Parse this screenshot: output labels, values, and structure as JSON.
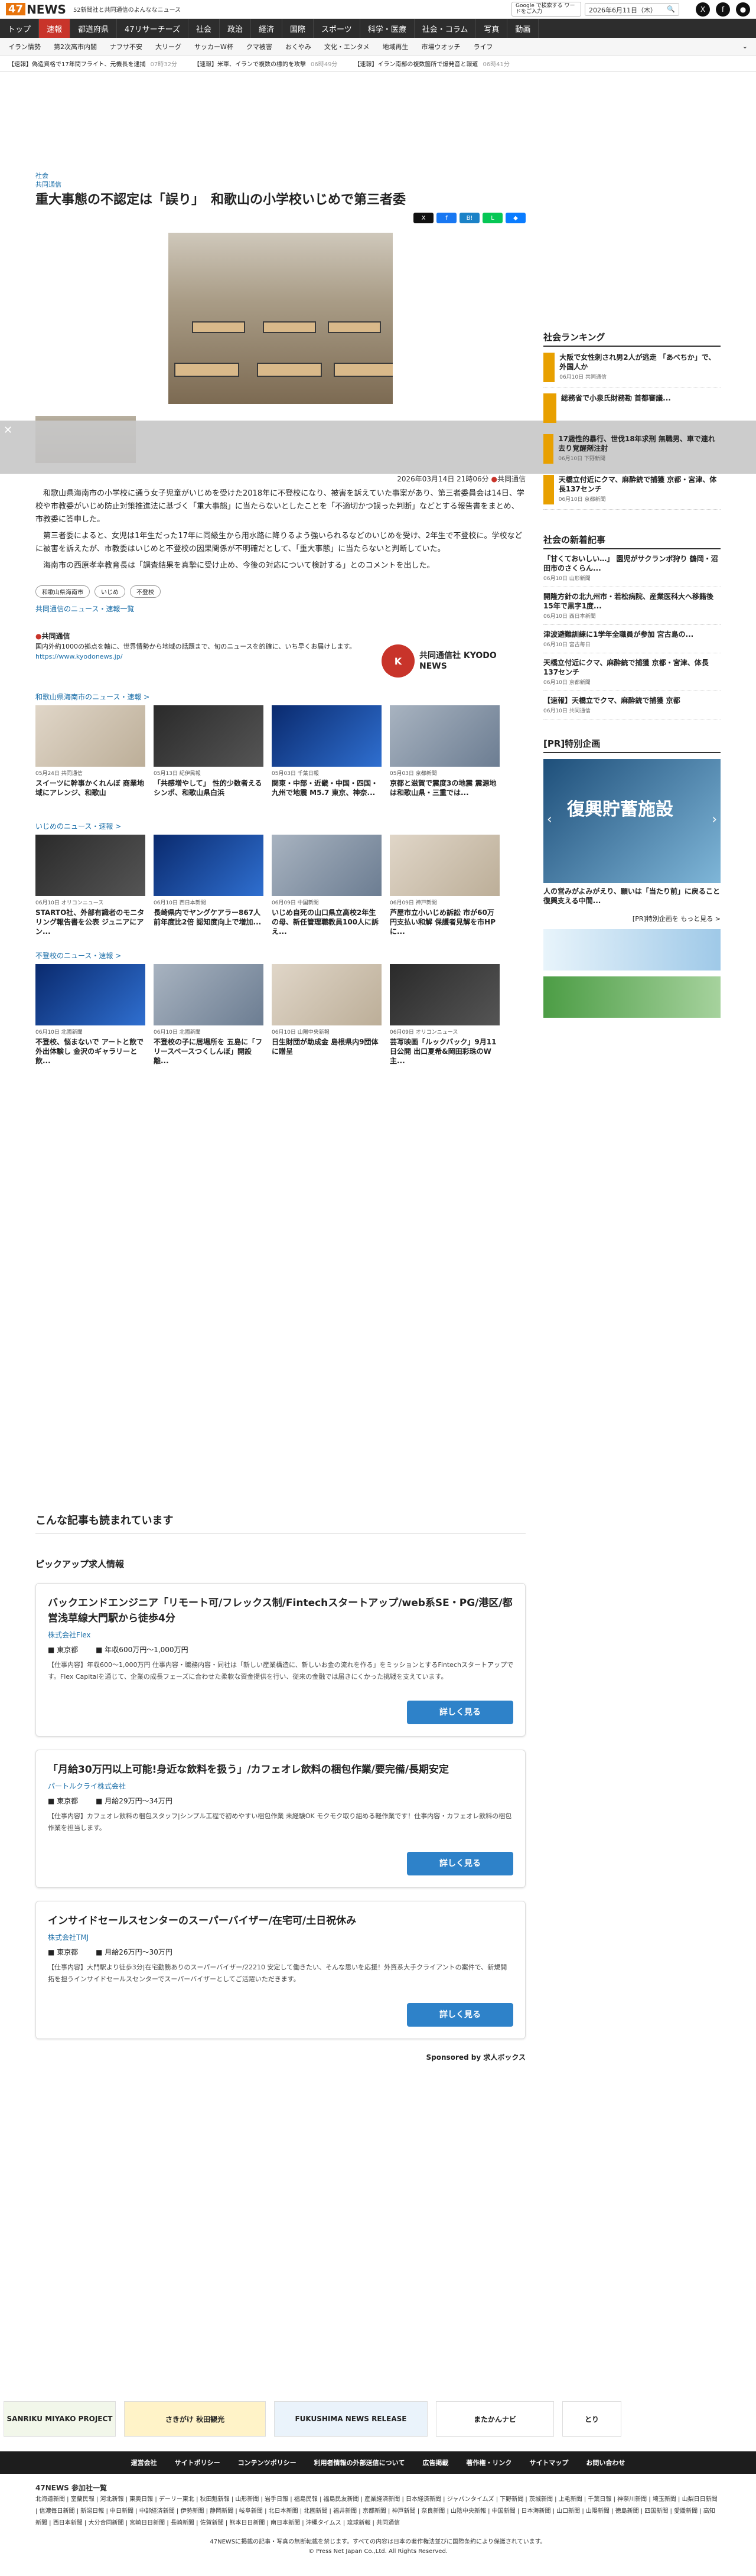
{
  "header": {
    "logo": "47NEWS",
    "tagline": "52新聞社と共同通信のよんななニュース",
    "google": "Google で検索する ワードをご入力",
    "date": "2026年6月11日（木）"
  },
  "nav": [
    "トップ",
    "速報",
    "都道府県",
    "47リサーチーズ",
    "社会",
    "政治",
    "経済",
    "国際",
    "スポーツ",
    "科学・医療",
    "社会・コラム",
    "写真",
    "動画"
  ],
  "subnav": [
    "イラン情勢",
    "第2次高市内閣",
    "ナフサ不安",
    "大リーグ",
    "サッカーW杯",
    "クマ被害",
    "おくやみ",
    "文化・エンタメ",
    "地域再生",
    "市場ウオッチ",
    "ライフ"
  ],
  "ticker": [
    {
      "t": "【速報】偽造資格で17年間フライト、元機長を逮捕",
      "time": "07時32分"
    },
    {
      "t": "【速報】米軍、イランで複数の標的を攻撃",
      "time": "06時49分"
    },
    {
      "t": "【速報】イラン南部の複数箇所で爆発音と報道",
      "time": "06時41分"
    }
  ],
  "article": {
    "category": "社会",
    "source_label": "共同通信",
    "title": "重大事態の不認定は「誤り」　和歌山の小学校いじめで第三者委",
    "meta": "2026年03月14日 21時06分",
    "meta_src": "共同通信",
    "paragraphs": [
      "和歌山県海南市の小学校に通う女子児童がいじめを受けた2018年に不登校になり、被害を訴えていた事案があり、第三者委員会は14日、学校や市教委がいじめ防止対策推進法に基づく「重大事態」に当たらないとしたことを「不適切かつ誤った判断」などとする報告書をまとめ、市教委に答申した。",
      "第三者委によると、女児は1年生だった17年に同級生から用水路に降りるよう強いられるなどのいじめを受け、2年生で不登校に。学校などに被害を訴えたが、市教委はいじめと不登校の因果関係が不明確だとして、「重大事態」に当たらないと判断していた。",
      "海南市の西原孝幸教育長は「調査結果を真摯に受け止め、今後の対応について検討する」とのコメントを出した。"
    ],
    "tags": [
      "和歌山県海南市",
      "いじめ",
      "不登校"
    ],
    "list_link": "共同通信のニュース・速報一覧"
  },
  "kyodo": {
    "name": "共同通信",
    "desc": "国内外約1000の拠点を軸に、世界情勢から地域の話題まで、旬のニュースを的確に、いち早くお届けします。",
    "url": "https://www.kyodonews.jp/",
    "logo": "共同通信社 KYODO NEWS"
  },
  "sections": [
    {
      "title": "和歌山県海南市のニュース・速報 >",
      "cards": [
        {
          "src": "05月24日 共同通信",
          "t": "スイーツに幹事かくれんぼ 商業地域にアレンジ、和歌山"
        },
        {
          "src": "05月13日 紀伊民報",
          "t": "「共感増やして」 性的少数者えるシンポ、和歌山県白浜"
        },
        {
          "src": "05月03日 千葉日報",
          "t": "関東・中部・近畿・中国・四国・九州で地震 M5.7 東京、神奈..."
        },
        {
          "src": "05月03日 京都新聞",
          "t": "京都と滋賀で震度3の地震 震源地は和歌山県・三重では..."
        }
      ]
    },
    {
      "title": "いじめのニュース・速報 >",
      "cards": [
        {
          "src": "06月10日 オリコンニュース",
          "t": "STARTO社、外部有識者のモニタリング報告書を公表 ジュニアにアン..."
        },
        {
          "src": "06月10日 西日本新聞",
          "t": "長崎県内でヤングケアラー867人 前年度比2倍 認知度向上で増加..."
        },
        {
          "src": "06月09日 中国新聞",
          "t": "いじめ自死の山口県立高校2年生の母、新任管理職教員100人に訴え..."
        },
        {
          "src": "06月09日 神戸新聞",
          "t": "芦屋市立小いじめ訴訟 市が60万円支払い和解 保護者見解を市HPに..."
        }
      ]
    },
    {
      "title": "不登校のニュース・速報 >",
      "cards": [
        {
          "src": "06月10日 北國新聞",
          "t": "不登校、悩まないで アートと飲で外出体験し 金沢のギャラリーと飲..."
        },
        {
          "src": "06月10日 北國新聞",
          "t": "不登校の子に居場所を 五島に「フリースペースつくしんぼ」開設 離..."
        },
        {
          "src": "06月10日 山陽中央新報",
          "t": "日生財団が助成金 島根県内9団体に贈呈"
        },
        {
          "src": "06月09日 オリコンニュース",
          "t": "芸写映画「ルックバック」9月11日公開 出口夏希&岡田彩珠のW主..."
        }
      ]
    }
  ],
  "ranking": {
    "title": "社会ランキング",
    "items": [
      {
        "t": "大阪で女性刺され男2人が逃走 「あべちか」で、外国人か",
        "s": "06月10日 共同通信"
      },
      {
        "t": "総務省で小泉氏財務勘 首都審議...",
        "s": ""
      },
      {
        "t": "17歳性的暴行、世伐18年求刑 無職男、車で連れ去り覚醒剤注射",
        "s": "06月10日 下野新聞"
      },
      {
        "t": "天橋立付近にクマ、麻酔銃で捕獲 京都・宮津、体長137センチ",
        "s": "06月10日 京都新聞"
      }
    ]
  },
  "newest": {
    "title": "社会の新着記事",
    "items": [
      {
        "t": "「甘くておいしい…」 園児がサクランボ狩り 鶴岡・沼田市のさくらん...",
        "s": "06月10日 山形新聞"
      },
      {
        "t": "開隆方針の北九州市・若松病院、産業医科大へ移籍後15年で黒字1度...",
        "s": "06月10日 西日本新聞"
      },
      {
        "t": "津波避難訓練に1学年全職員が参加 宮古島の...",
        "s": "06月10日 宮古毎日"
      },
      {
        "t": "天橋立付近にクマ、麻酔銃で捕獲 京都・宮津、体長137センチ",
        "s": "06月10日 京都新聞"
      },
      {
        "t": "【速報】天橋立でクマ、麻酔銃で捕獲 京都",
        "s": "06月10日 共同通信"
      }
    ]
  },
  "pr": {
    "title": "[PR]特別企画",
    "ad_text": "復興貯蓄施設",
    "caption": "人の営みがよみがえり、願いは「当たり前」に戻ること 復興支える中間...",
    "more": "[PR]特別企画を もっと見る >"
  },
  "jobs": {
    "read_more": "こんな記事も読まれています",
    "heading": "ピックアップ求人情報",
    "sponsor": "Sponsored by 求人ボックス",
    "items": [
      {
        "t": "バックエンドエンジニア「リモート可/フレックス制/Fintechスタートアップ/web系SE・PG/港区/都営浅草線大門駅から徒歩4分",
        "c": "株式会社Flex",
        "loc": "東京都",
        "pay": "年収600万円〜1,000万円",
        "d": "【仕事内容】年収600〜1,000万円 仕事内容・職務内容・同社は「新しい産業構造に、新しいお金の流れを作る」をミッションとするFintechスタートアップです。Flex Capitalを通じて、企業の成長フェーズに合わせた柔軟な資金提供を行い、従来の金融では届きにくかった挑戦を支えています。",
        "b": "詳しく見る"
      },
      {
        "t": "「月給30万円以上可能!身近な飲料を扱う」/カフェオレ飲料の梱包作業/要完備/長期安定",
        "c": "パートルクライ株式会社",
        "loc": "東京都",
        "pay": "月給29万円〜34万円",
        "d": "【仕事内容】カフェオレ飲料の梱包スタッフ|シンプル工程で初めやすい梱包作業 未経験OK モクモク取り組める軽作業です！仕事内容・カフェオレ飲料の梱包作業を担当します。",
        "b": "詳しく見る"
      },
      {
        "t": "インサイドセールスセンターのスーパーバイザー/在宅可/土日祝休み",
        "c": "株式会社TMJ",
        "loc": "東京都",
        "pay": "月給26万円〜30万円",
        "d": "【仕事内容】大門駅より徒歩3分|在宅勤務ありのスーパーバイザー/22210 安定して働きたい、そんな思いを応援！外資系大手クライアントの案件で、新規開拓を担うインサイドセールスセンターでスーパーバイザーとしてご活躍いただきます。",
        "b": "詳しく見る"
      }
    ]
  },
  "footer": {
    "banners": [
      "SANRIKU MIYAKO PROJECT",
      "さきがけ 秋田観光",
      "FUKUSHIMA NEWS RELEASE",
      "またかんナビ",
      "とり"
    ],
    "links": [
      "運営会社",
      "サイトポリシー",
      "コンテンツポリシー",
      "利用者情報の外部送信について",
      "広告掲載",
      "著作権・リンク",
      "サイトマップ",
      "お問い合わせ"
    ],
    "members_title": "47NEWS 参加社一覧",
    "members": "北海道新聞 | 室蘭民報 | 河北新報 | 東奥日報 | デーリー東北 | 秋田魁新報 | 山形新聞 | 岩手日報 | 福島民報 | 福島民友新聞 | 産業経済新聞 | 日本経済新聞 | ジャパンタイムズ | 下野新聞 | 茨城新聞 | 上毛新聞 | 千葉日報 | 神奈川新聞 | 埼玉新聞 | 山梨日日新聞 | 信濃毎日新聞 | 新潟日報 | 中日新聞 | 中部経済新聞 | 伊勢新聞 | 静岡新聞 | 岐阜新聞 | 北日本新聞 | 北國新聞 | 福井新聞 | 京都新聞 | 神戸新聞 | 奈良新聞 | 山陰中央新報 | 中国新聞 | 日本海新聞 | 山口新聞 | 山陽新聞 | 徳島新聞 | 四国新聞 | 愛媛新聞 | 高知新聞 | 西日本新聞 | 大分合同新聞 | 宮崎日日新聞 | 長崎新聞 | 佐賀新聞 | 熊本日日新聞 | 南日本新聞 | 沖縄タイムス | 琉球新報 | 共同通信",
    "copy1": "47NEWSに掲載の記事・写真の無断転載を禁じます。すべての内容は日本の著作権法並びに国際条約により保護されています。",
    "copy2": "© Press Net Japan Co.,Ltd. All Rights Reserved."
  }
}
